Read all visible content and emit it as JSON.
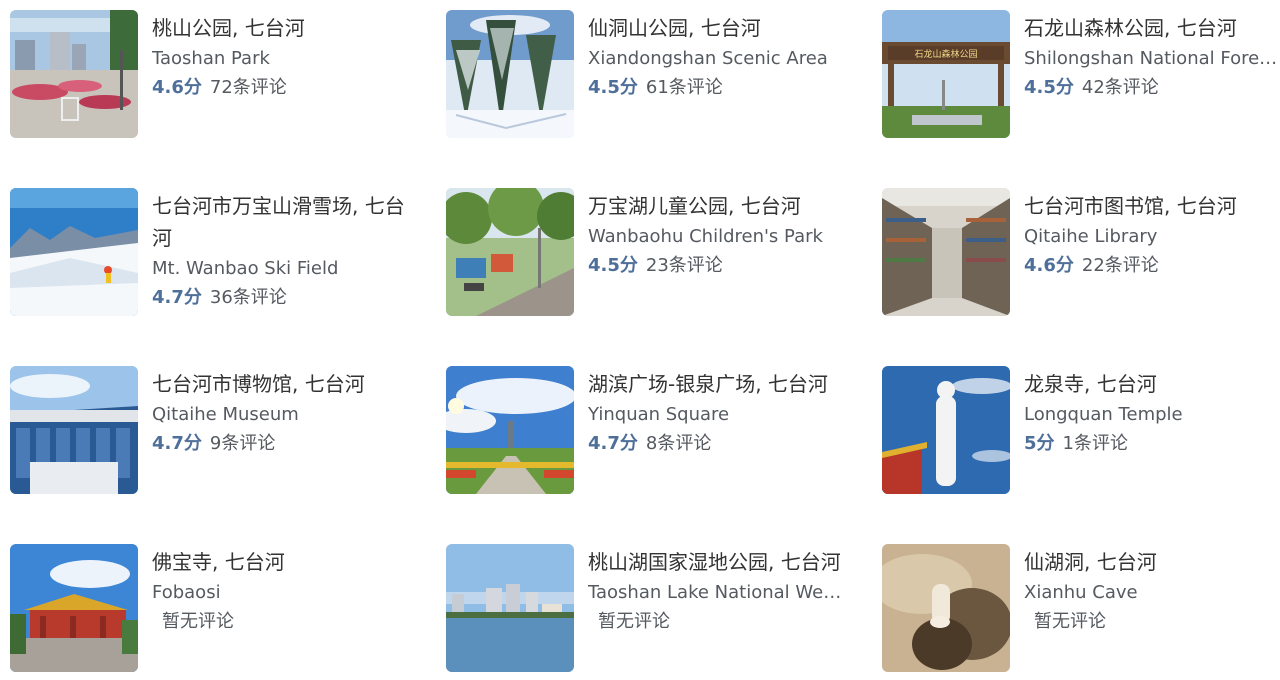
{
  "places": [
    {
      "title": "桃山公园, 七台河",
      "en": "Taoshan Park",
      "score": "4.6分",
      "reviews": "72条评论"
    },
    {
      "title": "仙洞山公园, 七台河",
      "en": "Xiandongshan Scenic Area",
      "score": "4.5分",
      "reviews": "61条评论"
    },
    {
      "title": "石龙山森林公园, 七台河",
      "en": "Shilongshan National Forest Park",
      "score": "4.5分",
      "reviews": "42条评论"
    },
    {
      "title": "七台河市万宝山滑雪场, 七台河",
      "en": "Mt. Wanbao Ski Field",
      "score": "4.7分",
      "reviews": "36条评论"
    },
    {
      "title": "万宝湖儿童公园, 七台河",
      "en": "Wanbaohu Children's Park",
      "score": "4.5分",
      "reviews": "23条评论"
    },
    {
      "title": "七台河市图书馆, 七台河",
      "en": "Qitaihe Library",
      "score": "4.6分",
      "reviews": "22条评论"
    },
    {
      "title": "七台河市博物馆, 七台河",
      "en": "Qitaihe Museum",
      "score": "4.7分",
      "reviews": "9条评论"
    },
    {
      "title": "湖滨广场-银泉广场, 七台河",
      "en": "Yinquan Square",
      "score": "4.7分",
      "reviews": "8条评论"
    },
    {
      "title": "龙泉寺, 七台河",
      "en": "Longquan Temple",
      "score": "5分",
      "reviews": "1条评论"
    },
    {
      "title": "佛宝寺, 七台河",
      "en": "Fobaosi",
      "no_reviews": "暂无评论"
    },
    {
      "title": "桃山湖国家湿地公园, 七台河",
      "en": "Taoshan Lake National Wetland Park",
      "no_reviews": "暂无评论"
    },
    {
      "title": "仙湖洞, 七台河",
      "en": "Xianhu Cave",
      "no_reviews": "暂无评论"
    }
  ],
  "colors": {
    "score": "#4e6f9a",
    "title": "#333333",
    "secondary": "#555a60"
  },
  "gate_sign_text": "石龙山森林公园"
}
